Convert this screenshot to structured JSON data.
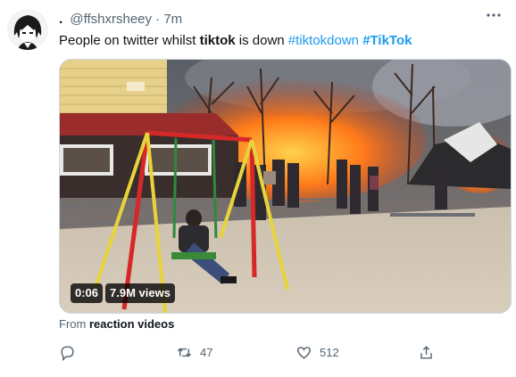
{
  "tweet": {
    "prefix": ".",
    "handle": "@ffshxrsheey",
    "separator": "·",
    "time": "7m",
    "text_part1": "People on twitter whilst ",
    "text_bold": "tiktok",
    "text_part2": " is down ",
    "hashtag1": "#tiktokdown",
    "hashtag2": "#TikTok",
    "more_icon": "more-icon"
  },
  "video": {
    "duration": "0:06",
    "views": "7.9M views"
  },
  "source": {
    "prefix": "From",
    "name": "reaction videos"
  },
  "actions": {
    "reply_count": "",
    "retweet_count": "47",
    "like_count": "512",
    "share_count": ""
  },
  "colors": {
    "accent": "#1d9bf0",
    "muted": "#536471",
    "text": "#0f1419"
  }
}
